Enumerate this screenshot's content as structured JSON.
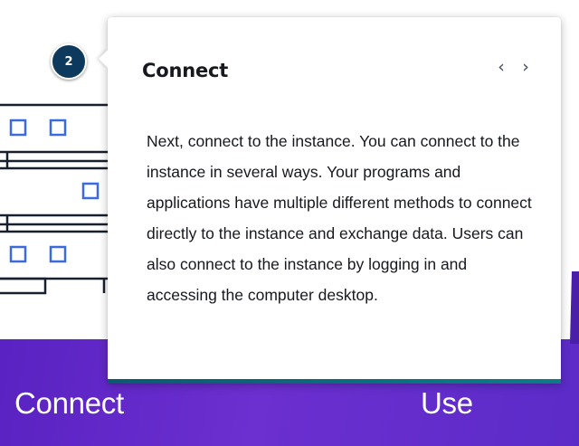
{
  "step_badge": {
    "number": "2"
  },
  "popover": {
    "title": "Connect",
    "prev_label": "‹",
    "next_label": "›",
    "body": "Next, connect to the instance. You can connect to the instance in several ways. Your programs and applications have multiple different methods to connect directly to the instance and exchange data. Users can also connect to the instance by logging in and accessing the computer desktop."
  },
  "band": {
    "left_label": "Connect",
    "right_label": "Use"
  },
  "icons": {
    "server_illustration": "server-stack-icon",
    "prev": "chevron-left-icon",
    "next": "chevron-right-icon"
  },
  "colors": {
    "band": "#5a22c2",
    "badge": "#0d3a5c",
    "server_square": "#3a6bd8",
    "footer_bar": "#0a5a6e"
  }
}
